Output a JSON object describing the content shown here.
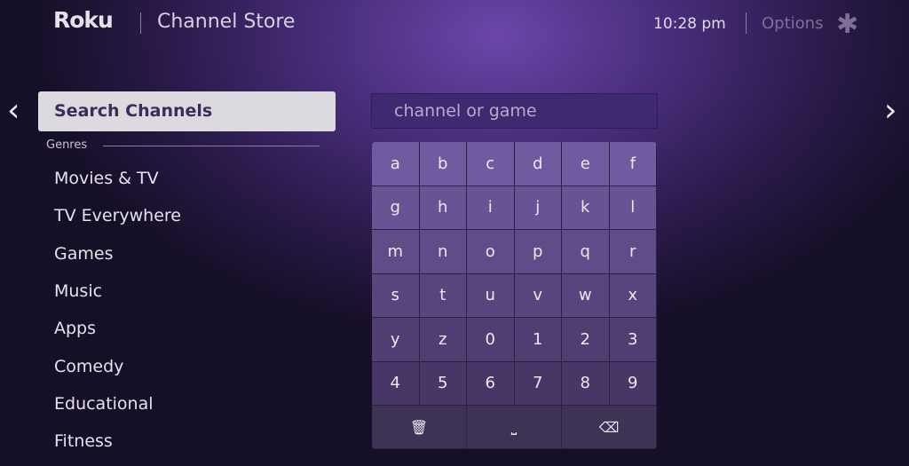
{
  "header": {
    "logo": "Roku",
    "title": "Channel Store",
    "time": "10:28  pm",
    "options_label": "Options",
    "options_icon": "✱"
  },
  "nav": {
    "left_arrow": "‹",
    "right_arrow": "›"
  },
  "sidebar": {
    "search_label": "Search Channels",
    "genres_label": "Genres",
    "genres": [
      "Movies & TV",
      "TV Everywhere",
      "Games",
      "Music",
      "Apps",
      "Comedy",
      "Educational",
      "Fitness"
    ]
  },
  "search": {
    "placeholder": "channel or game",
    "value": ""
  },
  "keyboard": {
    "rows": [
      [
        "a",
        "b",
        "c",
        "d",
        "e",
        "f"
      ],
      [
        "g",
        "h",
        "i",
        "j",
        "k",
        "l"
      ],
      [
        "m",
        "n",
        "o",
        "p",
        "q",
        "r"
      ],
      [
        "s",
        "t",
        "u",
        "v",
        "w",
        "x"
      ],
      [
        "y",
        "z",
        "0",
        "1",
        "2",
        "3"
      ],
      [
        "4",
        "5",
        "6",
        "7",
        "8",
        "9"
      ]
    ],
    "bottom": [
      {
        "name": "clear-key",
        "icon": "trash-icon",
        "glyph": "🗑"
      },
      {
        "name": "space-key",
        "icon": "space-icon",
        "glyph": "⎵"
      },
      {
        "name": "backspace-key",
        "icon": "backspace-icon",
        "glyph": "⌫"
      }
    ]
  }
}
